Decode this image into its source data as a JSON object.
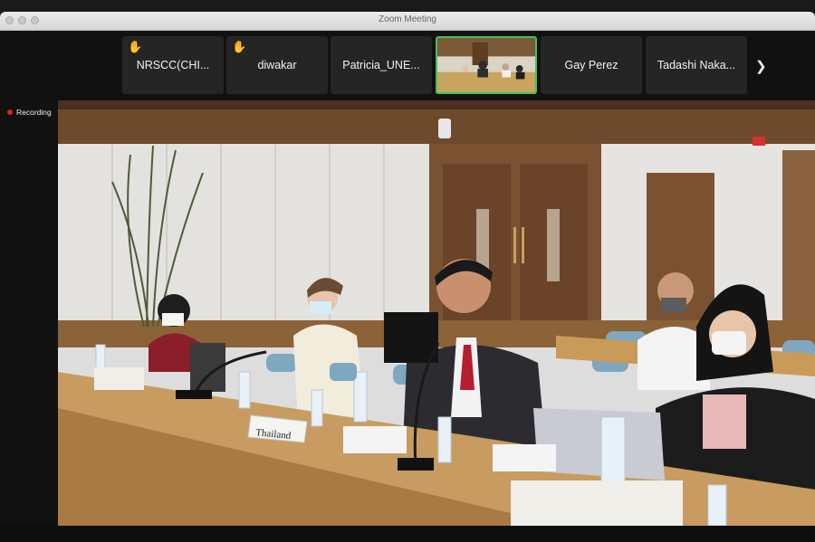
{
  "window": {
    "title": "Zoom Meeting"
  },
  "participants": [
    {
      "name": "NRSCC(CHI...",
      "raised_hand": true
    },
    {
      "name": "diwakar",
      "raised_hand": true
    },
    {
      "name": "Patricia_UNE...",
      "raised_hand": false
    },
    {
      "name": "",
      "raised_hand": false,
      "video": true,
      "active_speaker": true
    },
    {
      "name": "Gay Perez",
      "raised_hand": false
    },
    {
      "name": "Tadashi Naka...",
      "raised_hand": false
    }
  ],
  "recording": {
    "label": "Recording"
  },
  "video": {
    "nameplate": "Thailand"
  },
  "colors": {
    "speaker_border": "#3ec35a",
    "recording_dot": "#e02020"
  },
  "icons": {
    "hand": "raised-hand-icon",
    "next": "chevron-right-icon"
  }
}
